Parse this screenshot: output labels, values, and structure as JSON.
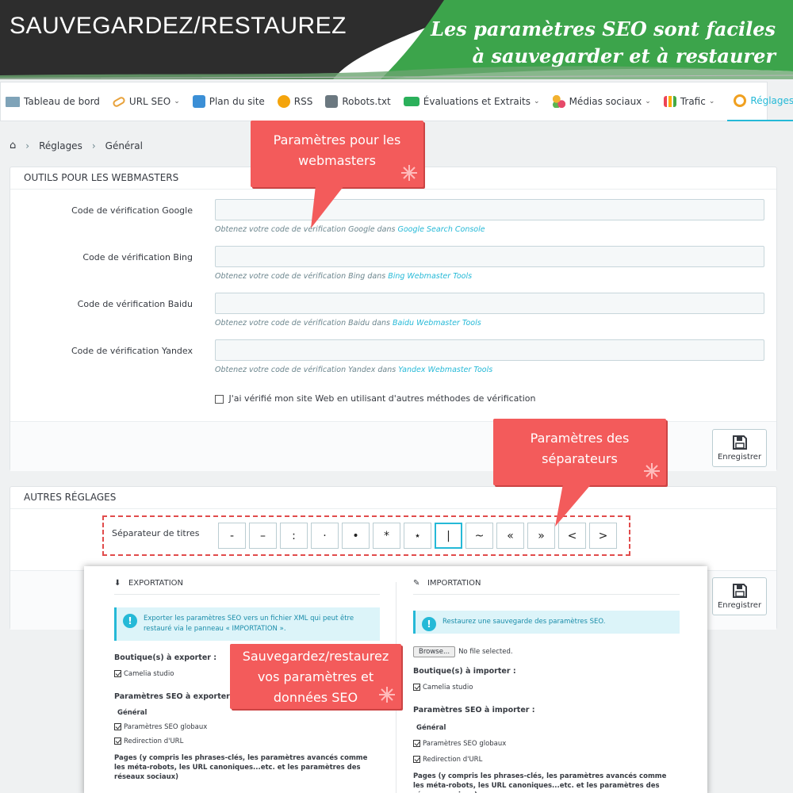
{
  "banner": {
    "title": "SAUVEGARDEZ/RESTAUREZ",
    "tagline_line1": "Les paramètres SEO sont faciles",
    "tagline_line2": "à sauvegarder et à restaurer"
  },
  "nav": {
    "items": [
      {
        "label": "Tableau de bord",
        "icon": "monitor-icon"
      },
      {
        "label": "URL SEO",
        "icon": "link-icon"
      },
      {
        "label": "Plan du site",
        "icon": "sitemap-icon"
      },
      {
        "label": "RSS",
        "icon": "rss-icon"
      },
      {
        "label": "Robots.txt",
        "icon": "robot-icon"
      },
      {
        "label": "Évaluations et Extraits",
        "icon": "rating-icon"
      },
      {
        "label": "Médias sociaux",
        "icon": "social-icon"
      },
      {
        "label": "Trafic",
        "icon": "chart-icon"
      },
      {
        "label": "Réglages",
        "icon": "gears-icon"
      }
    ]
  },
  "breadcrumb": {
    "level1": "Réglages",
    "level2": "Général"
  },
  "webmasters": {
    "heading": "OUTILS POUR LES WEBMASTERS",
    "google_label": "Code de vérification Google",
    "google_help": "Obtenez votre code de vérification Google dans ",
    "google_link": "Google Search Console",
    "bing_label": "Code de vérification Bing",
    "bing_help": "Obtenez votre code de vérification Bing dans ",
    "bing_link": "Bing Webmaster Tools",
    "baidu_label": "Code de vérification Baidu",
    "baidu_help": "Obtenez votre code de vérification Baidu dans ",
    "baidu_link": "Baidu Webmaster Tools",
    "yandex_label": "Code de vérification Yandex",
    "yandex_help": "Obtenez votre code de vérification Yandex dans ",
    "yandex_link": "Yandex Webmaster Tools",
    "other_methods": "J'ai vérifié mon site Web en utilisant d'autres méthodes de vérification",
    "save": "Enregistrer"
  },
  "other": {
    "heading": "AUTRES RÉGLAGES",
    "separator_label": "Séparateur de titres",
    "separators": [
      "-",
      "–",
      ":",
      "·",
      "•",
      "*",
      "⋆",
      "|",
      "~",
      "«",
      "»",
      "<",
      ">"
    ],
    "save": "Enregistrer"
  },
  "callouts": {
    "webmasters": "Paramètres pour les webmasters",
    "separators": "Paramètres des séparateurs",
    "backup": "Sauvegardez/restaurez vos paramètres et données SEO"
  },
  "export": {
    "heading": "EXPORTATION",
    "info": "Exporter les paramètres SEO vers un fichier XML qui peut être restauré via le panneau « IMPORTATION ».",
    "shops_label": "Boutique(s) à exporter :",
    "shop": "Camelia studio",
    "params_label": "Paramètres SEO à exporter :",
    "general": "Général",
    "global": "Paramètres SEO globaux",
    "redirect": "Redirection d'URL",
    "pages": "Pages (y compris les phrases-clés, les paramètres avancés comme les méta-robots, les URL canoniques...etc. et les paramètres des réseaux sociaux)"
  },
  "import": {
    "heading": "IMPORTATION",
    "info": "Restaurez une sauvegarde des paramètres SEO.",
    "browse": "Browse...",
    "no_file": "No file selected.",
    "shops_label": "Boutique(s) à importer :",
    "shop": "Camelia studio",
    "params_label": "Paramètres SEO à importer :",
    "general": "Général",
    "global": "Paramètres SEO globaux",
    "redirect": "Redirection d'URL",
    "pages": "Pages (y compris les phrases-clés, les paramètres avancés comme les méta-robots, les URL canoniques...etc. et les paramètres des réseaux sociaux)"
  },
  "colors": {
    "accent": "#25b9d7",
    "callout": "#f35b5b",
    "banner_dark": "#2f2f2f",
    "banner_green": "#3aa14a"
  }
}
